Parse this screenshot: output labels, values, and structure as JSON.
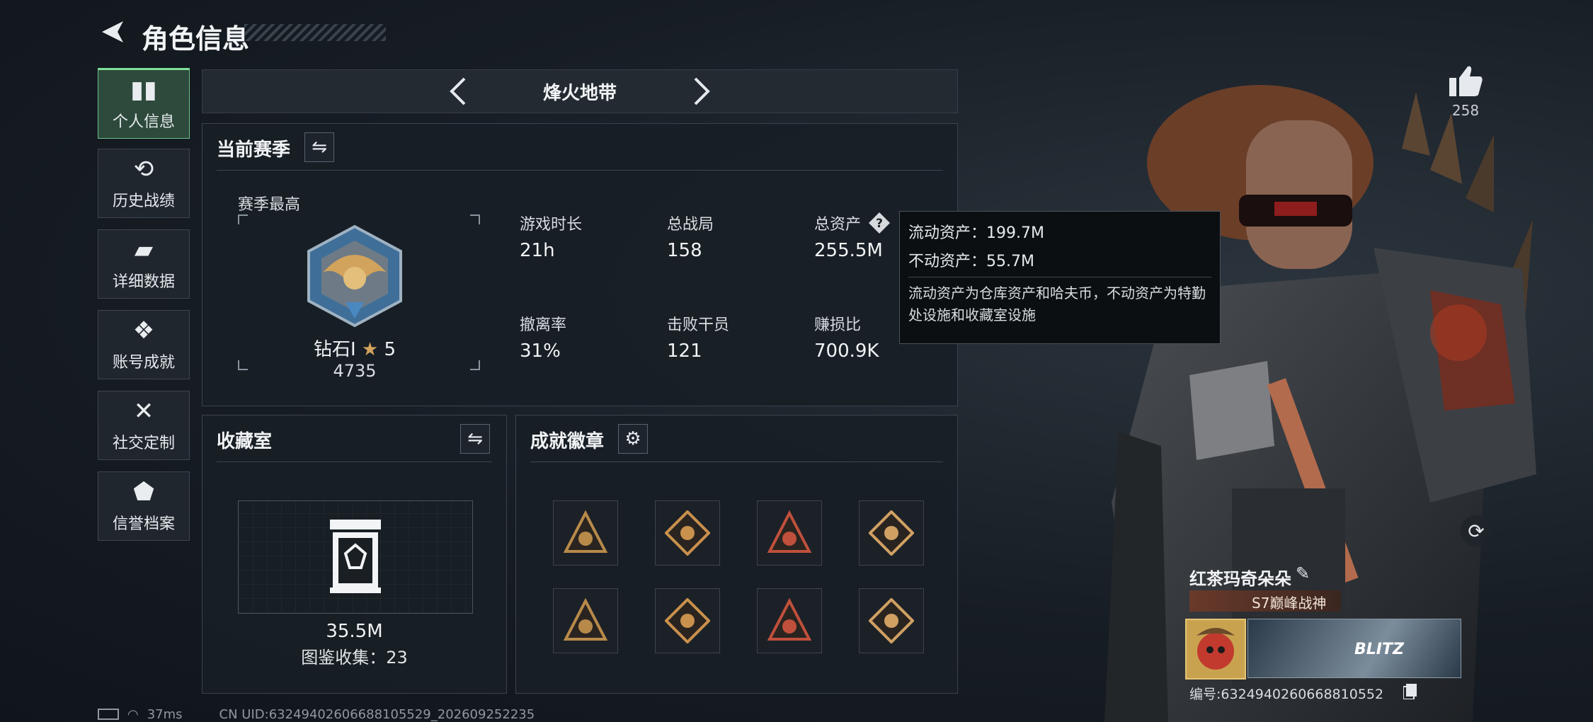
{
  "header": {
    "title": "角色信息"
  },
  "sidebar": {
    "items": [
      {
        "label": "个人信息",
        "icon": "bar-chart-icon",
        "active": true
      },
      {
        "label": "历史战绩",
        "icon": "history-icon"
      },
      {
        "label": "详细数据",
        "icon": "folder-icon"
      },
      {
        "label": "账号成就",
        "icon": "achievement-icon"
      },
      {
        "label": "社交定制",
        "icon": "tools-icon"
      },
      {
        "label": "信誉档案",
        "icon": "credit-icon"
      }
    ]
  },
  "mode_selector": {
    "label": "烽火地带"
  },
  "season": {
    "title": "当前赛季",
    "peak_label": "赛季最高",
    "rank_name": "钻石Ⅰ",
    "rank_stars": "5",
    "rank_score": "4735",
    "stats": [
      {
        "label": "游戏时长",
        "value": "21h"
      },
      {
        "label": "总战局",
        "value": "158"
      },
      {
        "label": "总资产",
        "value": "255.5M"
      },
      {
        "label": "撤离率",
        "value": "31%"
      },
      {
        "label": "击败干员",
        "value": "121"
      },
      {
        "label": "赚损比",
        "value": "700.9K"
      }
    ]
  },
  "tooltip": {
    "line1": "流动资产：199.7M",
    "line2": "不动资产：55.7M",
    "description": "流动资产为仓库资产和哈夫币，不动资产为特勤处设施和收藏室设施"
  },
  "collection": {
    "title": "收藏室",
    "value": "35.5M",
    "catalog_label": "图鉴收集：23"
  },
  "badges": {
    "title": "成就徽章",
    "colors": [
      "#b88a4a",
      "#c9914d",
      "#c0503c",
      "#d0a063"
    ]
  },
  "profile": {
    "likes": "258",
    "name": "红茶玛奇朵朵",
    "title_tag": "S7巅峰战神",
    "card_text": "BLITZ",
    "id_number": "编号:6324940260668810552"
  },
  "status_bar": {
    "ping": "37ms",
    "uid": "CN UID:6324940260668810552​9_202609252235"
  },
  "colors": {
    "accent_green": "#7ee09a",
    "panel": "#181e25",
    "gold": "#d2a35c"
  }
}
